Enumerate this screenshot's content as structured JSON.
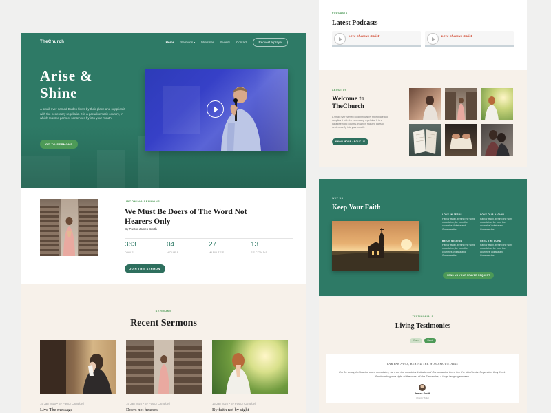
{
  "hero": {
    "logo": "TheChurch",
    "nav": [
      {
        "label": "Home",
        "active": true
      },
      {
        "label": "Sermons",
        "has_caret": true
      },
      {
        "label": "Ministries"
      },
      {
        "label": "Events"
      },
      {
        "label": "Contact"
      }
    ],
    "nav_cta": "Request a prayer",
    "title_line1": "Arise &",
    "title_line2": "Shine",
    "description": "A small river named Duden flows by their place and supplies it with the necessary regelialia. It is a paradisematic country, in which roasted parts of sentences fly into your mouth.",
    "button": "GO TO SERMONS",
    "video_icon": "play-icon"
  },
  "upcoming": {
    "label": "UPCOMING SERMONS",
    "title": "We Must Be Doers of The Word Not Hearers Only",
    "by": "By Pastor James Smith",
    "counters": [
      {
        "num": "363",
        "unit": "DAYS"
      },
      {
        "num": "04",
        "unit": "HOURS"
      },
      {
        "num": "27",
        "unit": "MINUTES"
      },
      {
        "num": "13",
        "unit": "SECONDS"
      }
    ],
    "button": "JOIN THIS SERMON"
  },
  "recent": {
    "label": "SERMONS",
    "title": "Recent Sermons",
    "cards": [
      {
        "meta": "15 Jan 2020  •  By Pastor Campbell",
        "title": "Live The message"
      },
      {
        "meta": "15 Jan 2020  •  By Pastor Campbell",
        "title": "Doers not hearers"
      },
      {
        "meta": "15 Jan 2020  •  By Pastor Campbell",
        "title": "By faith not by sight"
      }
    ]
  },
  "podcasts": {
    "kicker": "PODCASTS",
    "title": "Latest Podcasts",
    "players": [
      {
        "title": "Love of Jesus Christ"
      },
      {
        "title": "Love of Jesus Christ"
      }
    ]
  },
  "welcome": {
    "kicker": "ABOUT US",
    "title": "Welcome to TheChurch",
    "description": "A small river named Duden flows by their place and supplies it with the necessary regelialia. It is a paradisematic country, in which roasted parts of sentences fly into your mouth.",
    "button": "KNOW MORE ABOUT US"
  },
  "faith": {
    "kicker": "WHY US",
    "title": "Keep Your Faith",
    "items": [
      {
        "title": "LOVE IN JESUS",
        "desc": "Far far away, behind the word mountains, far from the countries Vokalia and Consonantia."
      },
      {
        "title": "LOVE OUR NATION",
        "desc": "Far far away, behind the word mountains, far from the countries Vokalia and Consonantia."
      },
      {
        "title": "BE ON MISSION",
        "desc": "Far far away, behind the word mountains, far from the countries Vokalia and Consonantia."
      },
      {
        "title": "SEEK THE LORD",
        "desc": "Far far away, behind the word mountains, far from the countries Vokalia and Consonantia."
      }
    ],
    "button": "SEND US YOUR PRAYER REQUEST"
  },
  "testimonies": {
    "kicker": "TESTIMONIALS",
    "title": "Living Testimonies",
    "tabs": [
      "Prev",
      "Next"
    ],
    "quote_title": "FAR FAR AWAY, BEHIND THE WORD MOUNTAINS",
    "quote": "Far far away, behind the word mountains, far from the countries Vokalia and Consonantia, there live the blind texts. Separated they live in Bookmarksgrove right at the coast of the Semantics, a large language ocean.",
    "name": "James Smith",
    "role": "Church Visitor"
  },
  "colors": {
    "brand_green": "#2e7a66",
    "accent_green": "#4d9a57",
    "cream": "#f7f1ea",
    "podcast_title": "#d0452c"
  }
}
